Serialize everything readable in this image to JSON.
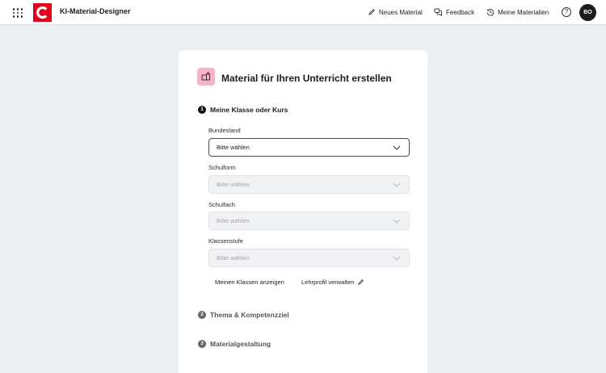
{
  "header": {
    "app_title": "KI-Material-Designer",
    "logo_text": "C",
    "nav": {
      "new_material": "Neues Material",
      "feedback": "Feedback",
      "my_materials": "Meine Materialien"
    },
    "help_label": "?",
    "user_initials": "BO"
  },
  "card": {
    "title": "Material für Ihren Unterricht erstellen",
    "steps": [
      {
        "num": "1",
        "label": "Meine Klasse oder Kurs"
      },
      {
        "num": "2",
        "label": "Thema & Kompetenzziel"
      },
      {
        "num": "3",
        "label": "Materialgestaltung"
      }
    ],
    "fields": [
      {
        "label": "Bundesland",
        "value": "Bitte wählen"
      },
      {
        "label": "Schulform",
        "value": "Bitte wählen"
      },
      {
        "label": "Schulfach",
        "value": "Bitte wählen"
      },
      {
        "label": "Klassenstufe",
        "value": "Bitte wählen"
      }
    ],
    "links": {
      "show_classes": "Meinen Klassen anzeigen",
      "manage_profile": "Lehrprofil verwalten"
    }
  },
  "colors": {
    "brand": "#e2001a",
    "accent_icon_bg": "#f6b4c8",
    "page_bg": "#eceef0"
  }
}
